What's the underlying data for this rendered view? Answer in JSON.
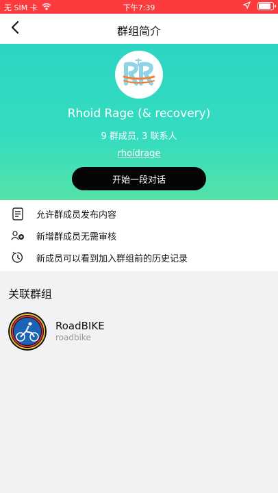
{
  "status_bar": {
    "carrier": "无 SIM 卡",
    "time": "下午7:39",
    "battery_level": 0.9
  },
  "nav": {
    "title": "群组简介",
    "back_icon": "chevron-left-icon"
  },
  "hero": {
    "group_name": "Rhoid Rage (& recovery)",
    "member_info": "9 群成员, 3 联系人",
    "handle": "rhoidrage",
    "start_chat_label": "开始一段对话",
    "gradient_top": "#2bd5c3",
    "gradient_bottom": "#55e3a8",
    "button_color": "#050505"
  },
  "settings": [
    {
      "icon": "document-icon",
      "label": "允许群成员发布内容"
    },
    {
      "icon": "add-member-icon",
      "label": "新增群成员无需审核"
    },
    {
      "icon": "history-icon",
      "label": "新成员可以看到加入群组前的历史记录"
    }
  ],
  "linked_groups": {
    "title": "关联群组",
    "items": [
      {
        "name": "RoadBIKE",
        "handle": "roadbike"
      }
    ]
  },
  "colors": {
    "status_bar": "#fc3b3e",
    "background": "#f2f2f4"
  }
}
